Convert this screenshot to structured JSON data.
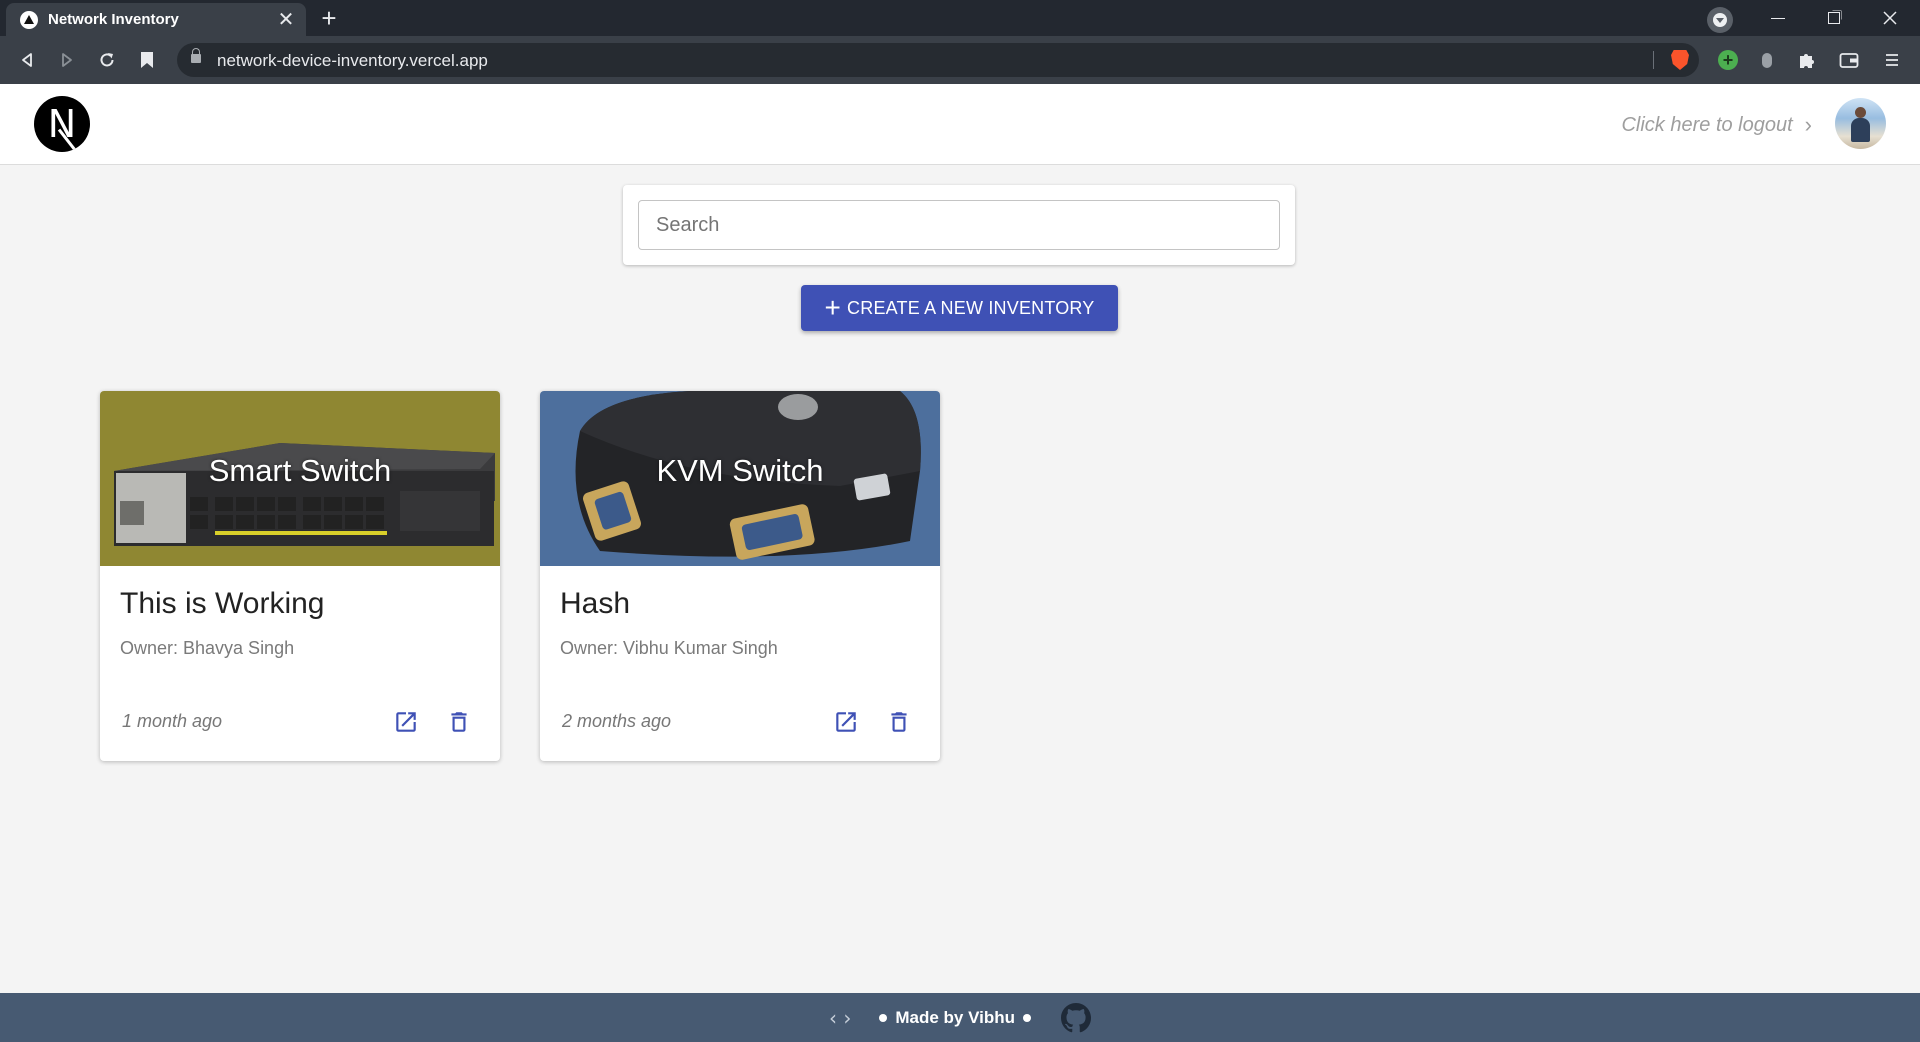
{
  "browser": {
    "tab_title": "Network Inventory",
    "url": "network-device-inventory.vercel.app",
    "tab_close_glyph": "✕",
    "new_tab_glyph": "+"
  },
  "header": {
    "logo_letter": "N",
    "logout_text": "Click here to logout",
    "logout_chevron": "›"
  },
  "search": {
    "placeholder": "Search",
    "value": ""
  },
  "create_button": {
    "icon": "+",
    "label": "CREATE A NEW INVENTORY",
    "color": "#3f51b5"
  },
  "inventories": [
    {
      "image_label": "Smart Switch",
      "title": "This is Working",
      "owner": "Owner: Bhavya Singh",
      "time": "1 month ago"
    },
    {
      "image_label": "KVM Switch",
      "title": "Hash",
      "owner": "Owner: Vibhu Kumar Singh",
      "time": "2 months ago"
    }
  ],
  "footer": {
    "code_icon": "‹ ›",
    "made_by": "Made by Vibhu",
    "background": "#475a72"
  },
  "icons": {
    "open": "open-in-new-icon",
    "delete": "trash-icon",
    "github": "github-icon"
  }
}
